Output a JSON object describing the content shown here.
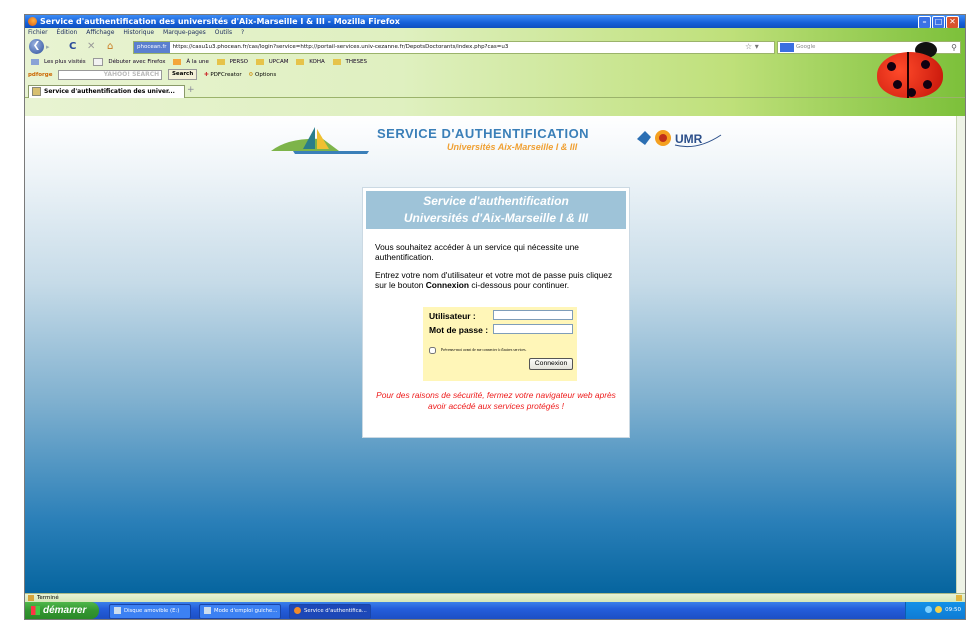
{
  "window": {
    "title": "Service d'authentification des universités d'Aix-Marseille I & III - Mozilla Firefox"
  },
  "menu": [
    "Fichier",
    "Édition",
    "Affichage",
    "Historique",
    "Marque-pages",
    "Outils",
    "?"
  ],
  "nav": {
    "site_badge": "phocean.fr",
    "url": "https://casu1u3.phocean.fr/cas/login?service=http://portail-services.univ-cezanne.fr/DepotsDoctorants/index.php?cas=u3",
    "search_placeholder": "Google"
  },
  "bookmarks": [
    "Les plus visités",
    "Débuter avec Firefox",
    "À la une",
    "PERSO",
    "UPCAM",
    "KOHA",
    "THESES"
  ],
  "toolbar": {
    "brand": "pdforge",
    "search_field": "YAHOO! SEARCH",
    "search_button": "Search",
    "pdfcreator": "PDFCreator",
    "options": "Options"
  },
  "tab": {
    "label": "Service d'authentification des univer..."
  },
  "page": {
    "logo_title": "SERVICE D'AUTHENTIFICATION",
    "logo_subtitle": "Universités Aix-Marseille I & III",
    "box_title_1": "Service d'authentification",
    "box_title_2": "Universités d'Aix-Marseille I & III",
    "intro": "Vous souhaitez accéder à un service qui nécessite une authentification.",
    "instr_before": "Entrez votre nom d'utilisateur et votre mot de passe puis cliquez sur le bouton ",
    "instr_bold": "Connexion",
    "instr_after": " ci-dessous pour continuer.",
    "user_label": "Utilisateur :",
    "pass_label": "Mot de passe :",
    "user_value": "",
    "pass_value": "",
    "warn_checkbox": "Prévenez-moi avant de me connecter à d'autres services.",
    "submit": "Connexion",
    "warning": "Pour des raisons de sécurité, fermez votre navigateur web après avoir accédé aux services protégés !"
  },
  "status": {
    "text": "Terminé"
  },
  "taskbar": {
    "start": "démarrer",
    "items": [
      "Disque amovible (E:)",
      "Mode d'emploi guiche...",
      "Service d'authentifica..."
    ],
    "clock": "09:50"
  },
  "colors": {
    "xp_blue": "#245edb",
    "logo_blue": "#3a7fb8",
    "logo_orange": "#f0a033",
    "box_header": "#9ec3d8",
    "form_yellow": "#fff6b8",
    "warning_red": "#ee1c1c"
  }
}
